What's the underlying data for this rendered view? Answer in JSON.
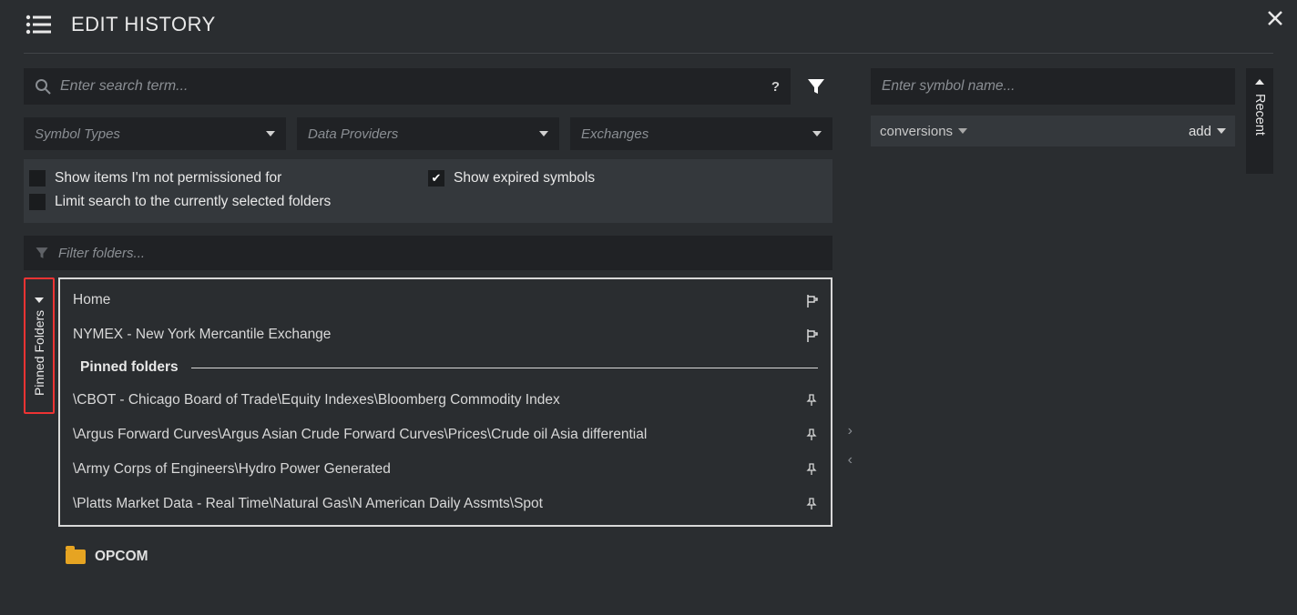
{
  "header": {
    "title": "EDIT HISTORY"
  },
  "search": {
    "placeholder": "Enter search term...",
    "help": "?"
  },
  "dropdowns": {
    "symbol_types": "Symbol Types",
    "data_providers": "Data Providers",
    "exchanges": "Exchanges"
  },
  "checkboxes": {
    "not_permissioned": {
      "label": "Show items I'm not permissioned for",
      "checked": false
    },
    "limit_search": {
      "label": "Limit search to the currently selected folders",
      "checked": false
    },
    "show_expired": {
      "label": "Show expired symbols",
      "checked": true
    }
  },
  "folders_filter": {
    "placeholder": "Filter folders..."
  },
  "pinned_tab_label": "Pinned Folders",
  "nav_items": {
    "home": "Home",
    "nymex": "NYMEX - New York Mercantile Exchange"
  },
  "pinned_header": "Pinned folders",
  "pinned_folders": [
    "\\CBOT - Chicago Board of Trade\\Equity Indexes\\Bloomberg Commodity Index",
    "\\Argus Forward Curves\\Argus Asian Crude Forward Curves\\Prices\\Crude oil Asia differential",
    "\\Army Corps of Engineers\\Hydro Power Generated",
    "\\Platts Market Data - Real Time\\Natural Gas\\N American Daily Assmts\\Spot"
  ],
  "tree_item": "OPCOM",
  "right": {
    "symbol_placeholder": "Enter symbol name...",
    "conversions_label": "conversions",
    "add_label": "add",
    "recent_label": "Recent"
  }
}
